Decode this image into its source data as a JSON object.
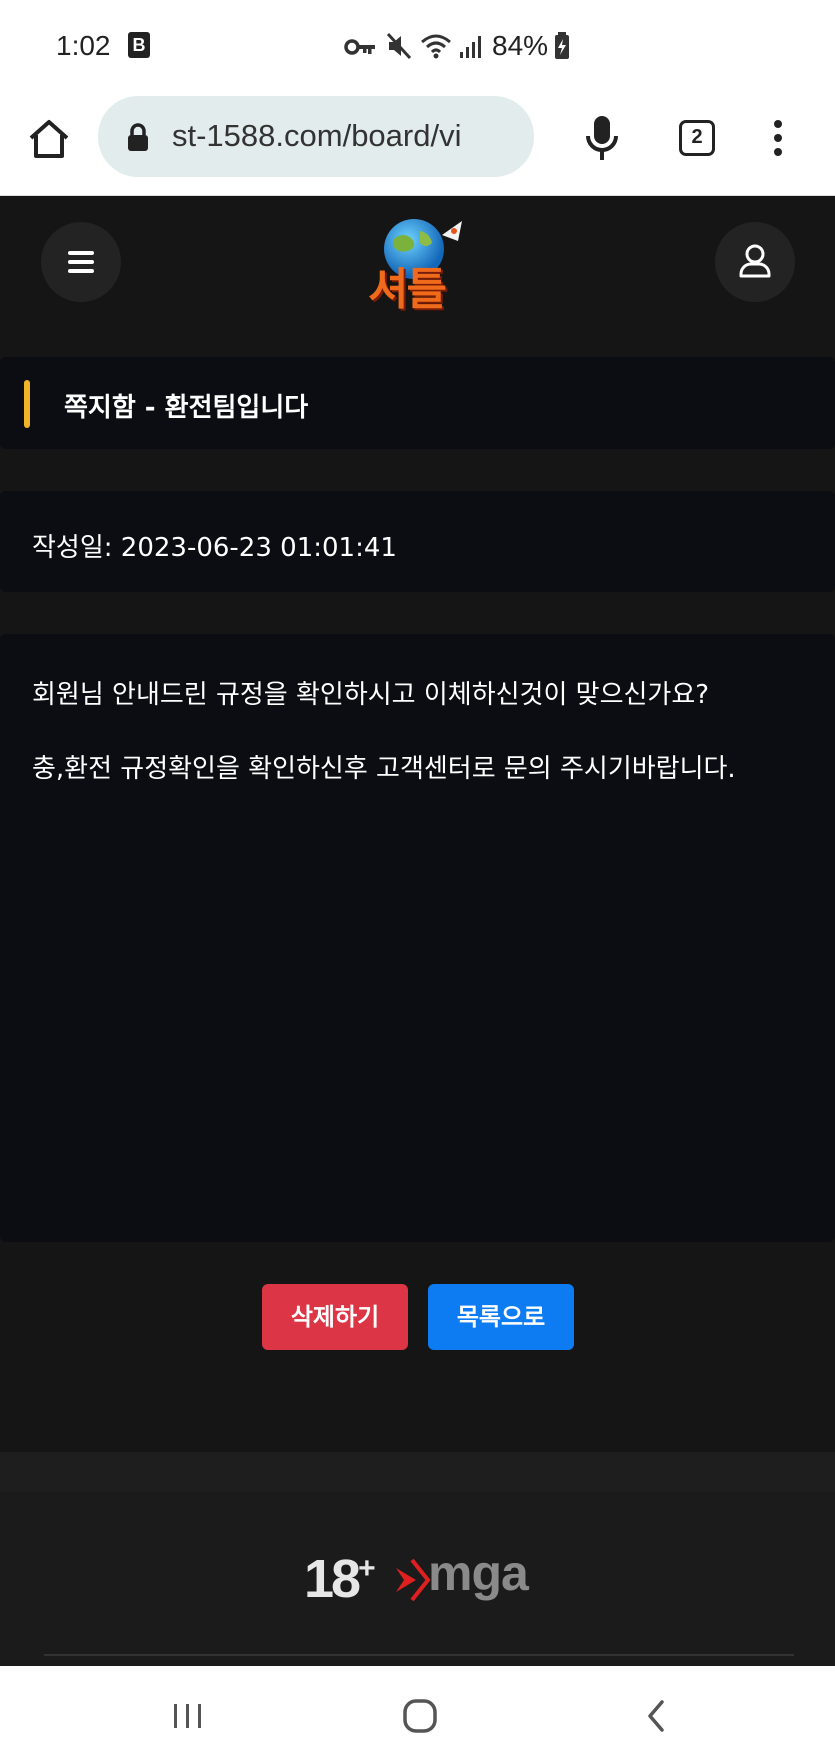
{
  "status_bar": {
    "time": "1:02",
    "app_badge": "B",
    "battery": "84%",
    "icons": [
      "key-icon",
      "mute-icon",
      "wifi-icon",
      "signal-icon",
      "battery-charging-icon"
    ]
  },
  "browser": {
    "url": "st-1588.com/board/vi",
    "tab_count": "2"
  },
  "site": {
    "logo_text": "셔틀"
  },
  "message": {
    "title": "쪽지함 - 환전팀입니다",
    "date": "작성일: 2023-06-23 01:01:41",
    "body_line1": "회원님 안내드린 규정을 확인하시고 이체하신것이 맞으신가요?",
    "body_line2": "충,환전 규정확인을 확인하신후 고객센터로 문의 주시기바랍니다."
  },
  "actions": {
    "delete_label": "삭제하기",
    "list_label": "목록으로"
  },
  "footer": {
    "age_badge": "18",
    "age_plus": "+",
    "mga_text": "mga"
  },
  "colors": {
    "accent": "#f0b429",
    "delete": "#dc3545",
    "primary": "#0d7cf2",
    "card_bg": "#0b0d12",
    "page_bg": "#151515"
  }
}
